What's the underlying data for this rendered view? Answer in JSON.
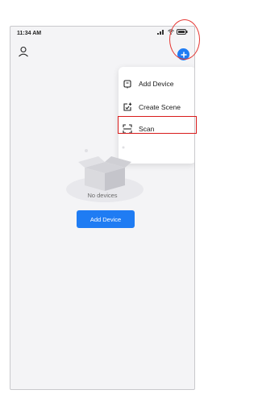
{
  "status_bar": {
    "time": "11:34 AM",
    "icons": [
      "signal-icon",
      "wifi-icon",
      "battery-icon"
    ]
  },
  "header": {
    "profile_icon": "profile-icon",
    "add_icon": "add-circle-icon"
  },
  "menu": {
    "items": [
      {
        "label": "Add Device",
        "icon": "add-device-icon"
      },
      {
        "label": "Create Scene",
        "icon": "create-scene-icon"
      },
      {
        "label": "Scan",
        "icon": "scan-icon"
      }
    ]
  },
  "empty_state": {
    "message": "No devices",
    "button_label": "Add Device"
  },
  "colors": {
    "accent": "#1f7cf3",
    "background": "#f4f4f6",
    "annotation": "#e53935"
  }
}
